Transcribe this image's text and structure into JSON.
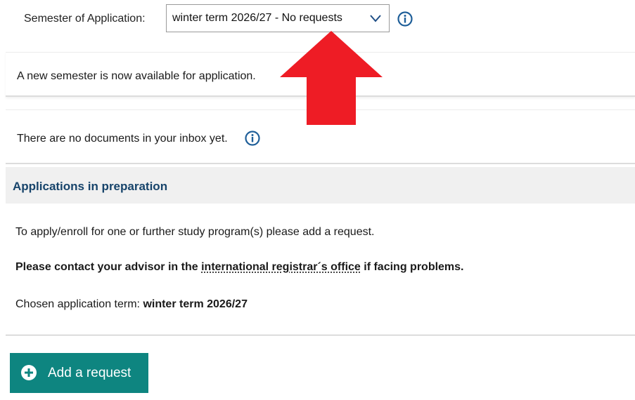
{
  "semester": {
    "label": "Semester of Application:",
    "selected": "winter term 2026/27 - No requests",
    "chevron_icon": "chevron-down-icon",
    "info_icon": "info-icon"
  },
  "notices": {
    "new_semester": "A new semester is now available for application.",
    "inbox_empty": "There are no documents in your inbox yet.",
    "info_icon": "info-icon"
  },
  "applications": {
    "title": "Applications in preparation",
    "instruction": "To apply/enroll for one or further study program(s) please add a request.",
    "contact_prefix": "Please contact your advisor in the ",
    "contact_link": "international registrar´s office",
    "contact_suffix": " if facing problems.",
    "chosen_term_label": "Chosen application term: ",
    "chosen_term_value": "winter term 2026/27"
  },
  "actions": {
    "add_request_label": "Add a request",
    "add_icon": "plus-circle-icon"
  },
  "colors": {
    "accent": "#0e8580",
    "heading": "#17446b",
    "info_icon": "#1f5f99",
    "annotation_arrow": "#ee1c25"
  }
}
